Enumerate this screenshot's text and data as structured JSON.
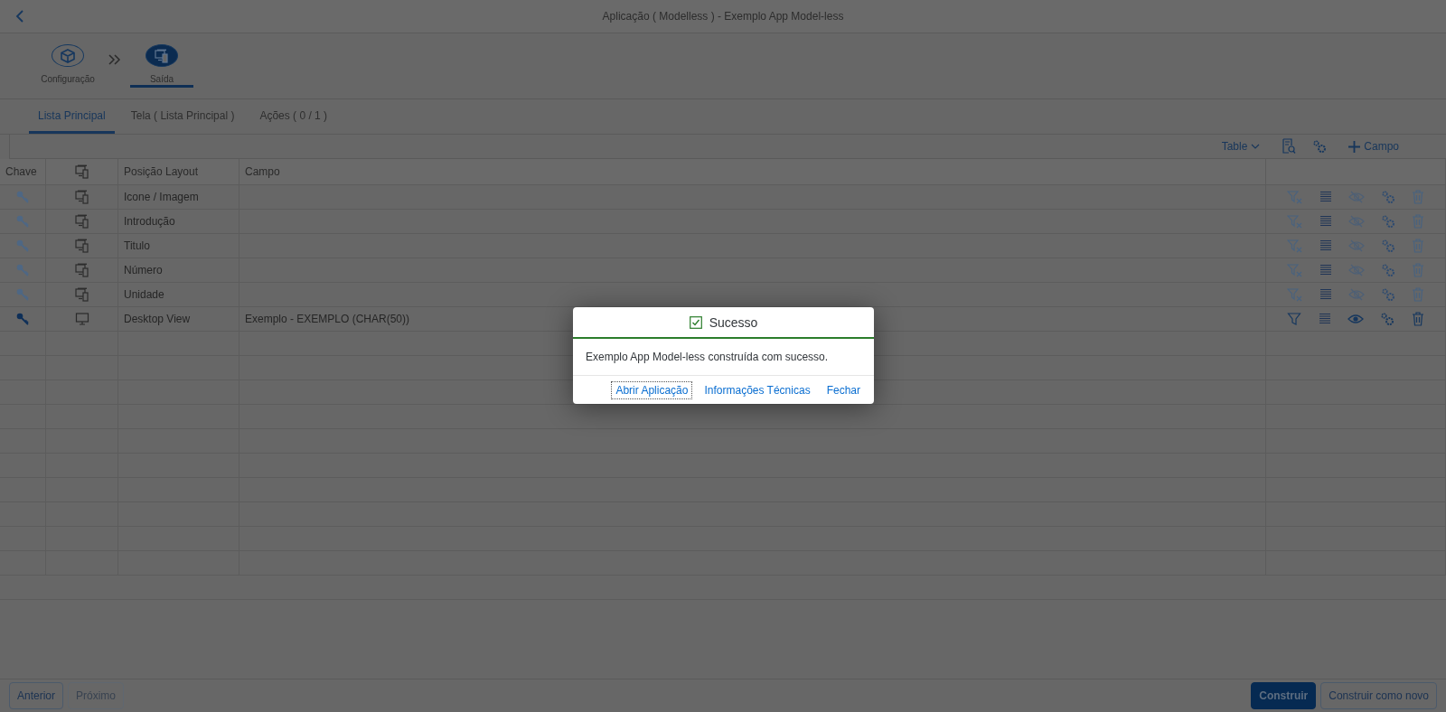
{
  "header": {
    "title": "Aplicação ( Modelless ) - Exemplo App Model-less"
  },
  "steps": [
    {
      "label": "Configuração",
      "selected": false
    },
    {
      "label": "Saída",
      "selected": true
    }
  ],
  "tabs": [
    {
      "label": "Lista Principal",
      "selected": true
    },
    {
      "label": "Tela ( Lista Principal )",
      "selected": false
    },
    {
      "label": "Ações ( 0 / 1 )",
      "selected": false
    }
  ],
  "toolbar": {
    "view": "Table",
    "add_label": "Campo"
  },
  "table": {
    "columns": [
      "Chave",
      "Posição Layout",
      "Campo"
    ],
    "rows": [
      {
        "active": false,
        "position": "Icone / Imagem"
      },
      {
        "active": false,
        "position": "Introdução"
      },
      {
        "active": false,
        "position": "Titulo"
      },
      {
        "active": false,
        "position": "Número"
      },
      {
        "active": false,
        "position": "Unidade"
      },
      {
        "active": true,
        "position": "Desktop View",
        "field": "Exemplo - EXEMPLO (CHAR(50))"
      }
    ]
  },
  "dialog": {
    "title": "Sucesso",
    "message": "Exemplo App Model-less construída com sucesso.",
    "buttons": [
      {
        "label": "Abrir Aplicação",
        "focused": true
      },
      {
        "label": "Informações Técnicas",
        "focused": false
      },
      {
        "label": "Fechar",
        "focused": false
      }
    ]
  },
  "footer": {
    "left": [
      {
        "label": "Anterior",
        "disabled": false
      },
      {
        "label": "Próximo",
        "disabled": true
      }
    ],
    "right": [
      {
        "label": "Construir",
        "emphasized": true
      },
      {
        "label": "Construir como novo",
        "emphasized": false
      }
    ]
  }
}
